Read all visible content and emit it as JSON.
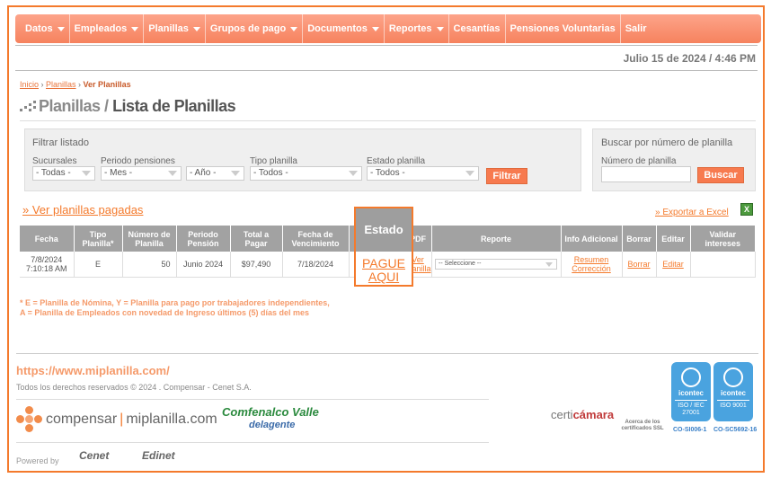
{
  "nav": {
    "items": [
      {
        "label": "Datos",
        "dropdown": true
      },
      {
        "label": "Empleados",
        "dropdown": true
      },
      {
        "label": "Planillas",
        "dropdown": true
      },
      {
        "label": "Grupos de pago",
        "dropdown": true
      },
      {
        "label": "Documentos",
        "dropdown": true
      },
      {
        "label": "Reportes",
        "dropdown": true
      },
      {
        "label": "Cesantías",
        "dropdown": false
      },
      {
        "label": "Pensiones Voluntarias",
        "dropdown": false
      },
      {
        "label": "Salir",
        "dropdown": false
      }
    ]
  },
  "datetime": "Julio 15 de 2024 / 4:46 PM",
  "breadcrumb": {
    "home": "Inicio",
    "section": "Planillas",
    "current": "Ver Planillas"
  },
  "page": {
    "title_prefix": "Planillas /",
    "title_main": "Lista de Planillas"
  },
  "filter": {
    "title": "Filtrar listado",
    "sucursales_label": "Sucursales",
    "sucursales_value": "- Todas -",
    "periodo_label": "Periodo pensiones",
    "mes_value": "- Mes -",
    "anio_value": "- Año -",
    "tipo_label": "Tipo planilla",
    "tipo_value": "- Todos -",
    "estado_label": "Estado planilla",
    "estado_value": "- Todos -",
    "button": "Filtrar"
  },
  "search": {
    "title": "Buscar por número de planilla",
    "label": "Número de planilla",
    "value": "",
    "button": "Buscar"
  },
  "links": {
    "paid": "» Ver planillas pagadas",
    "export": "» Exportar a Excel"
  },
  "table": {
    "headers": [
      "Fecha",
      "Tipo Planilla*",
      "Número de Planilla",
      "Periodo Pensión",
      "Total a Pagar",
      "Fecha de Vencimiento",
      "Estado",
      "PDF",
      "Reporte",
      "Info Adicional",
      "Borrar",
      "Editar",
      "Validar intereses"
    ],
    "row": {
      "fecha": "7/8/2024 7:10:18 AM",
      "tipo": "E",
      "numero": "50",
      "periodo": "Junio 2024",
      "total": "$97,490",
      "vencimiento": "7/18/2024",
      "estado": "PAGUE AQUI",
      "pdf": "Ver Planilla",
      "reporte": "-- Seleccione --",
      "info": "Resumen Corrección",
      "borrar": "Borrar",
      "editar": "Editar",
      "validar": ""
    }
  },
  "notes": {
    "line1": "* E = Planilla de Nómina, Y = Planilla para pago por trabajadores independientes,",
    "line2": "A = Planilla de Empleados con novedad de Ingreso últimos (5) días del mes"
  },
  "footer": {
    "url": "https://www.miplanilla.com/",
    "copyright": "Todos los derechos reservados © 2024 . Compensar - Cenet S.A.",
    "compensar_a": "compensar",
    "compensar_b": "miplanilla.com",
    "comfenalco_a": "Comfenalco Valle",
    "comfenalco_b": "delagente",
    "certi_a": "certi",
    "certi_b": "cámara",
    "certi_note": "Acerca de los certificados SSL",
    "icontec1": {
      "brand": "icontec",
      "std": "ISO / IEC 27001",
      "code": "CO-SI006-1"
    },
    "icontec2": {
      "brand": "icontec",
      "std": "ISO 9001",
      "code": "CO-SC5692-16"
    },
    "powered": "Powered by",
    "cenet": "Cenet",
    "edinet": "Edinet"
  },
  "colors": {
    "accent": "#f47a2c",
    "nav": "#f6825e",
    "header_gray": "#a2a2a2"
  }
}
